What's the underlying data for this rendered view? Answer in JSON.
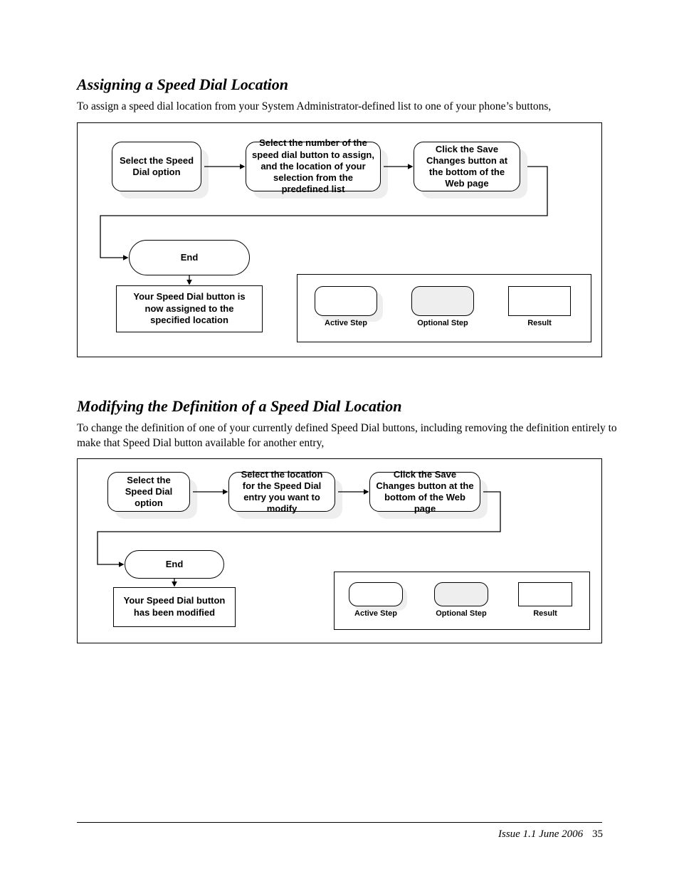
{
  "section1": {
    "title": "Assigning a Speed Dial Location",
    "desc": "To assign a speed dial location from your System Administrator-defined list to one of your phone’s buttons,"
  },
  "section2": {
    "title": "Modifying the Definition of a Speed Dial Location",
    "desc": "To change the definition of one of your currently defined Speed Dial buttons, including removing the definition entirely to make that Speed Dial button available for another entry,"
  },
  "flow1": {
    "blocks": [
      "Select the\nSpeed Dial\noption",
      "Select the number of the\nspeed dial button to\nassign, and the location\nof your selection from the\npredefined list",
      "Click the Save\nChanges button at\nthe bottom of the\nWeb page"
    ],
    "end": "End",
    "result": "Your Speed Dial button\nis now assigned to the\nspecified location"
  },
  "flow2": {
    "blocks": [
      "Select the\nSpeed Dial\noption",
      "Select the location for\nthe Speed Dial entry\nyou want to modify",
      "Click the Save Changes\nbutton at the bottom of the\nWeb page"
    ],
    "end": "End",
    "result": "Your Speed Dial\nbutton has been\nmodified"
  },
  "legend": {
    "active": "Active\nStep",
    "optional": "Optional\nStep",
    "result": "Result"
  },
  "footer_left": "Issue 1.1 June 2006",
  "footer_right": "35"
}
